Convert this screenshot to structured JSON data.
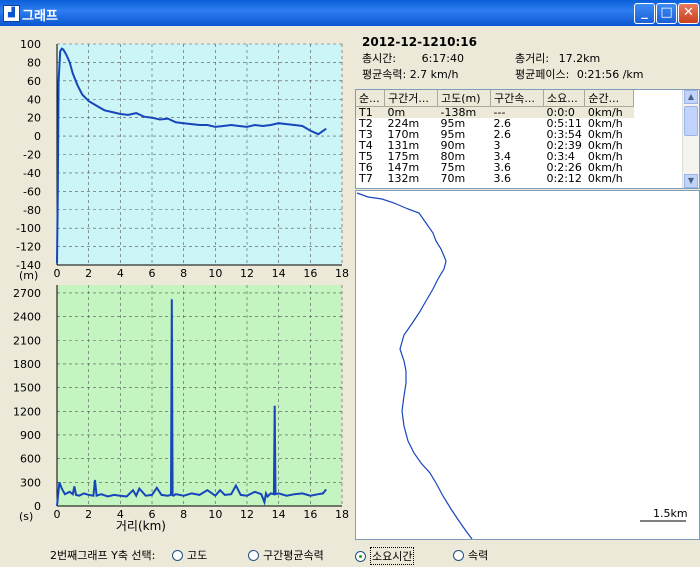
{
  "window": {
    "title": "그래프",
    "app_icon": "chart-icon"
  },
  "info": {
    "date": "2012-12-1210:16",
    "total_time_label": "총시간:",
    "total_time": "6:17:40",
    "total_distance_label": "총거리:",
    "total_distance": "17.2km",
    "avg_speed_label": "평균속력:",
    "avg_speed": "2.7 km/h",
    "avg_pace_label": "평균페이스:",
    "avg_pace": "0:21:56 /km"
  },
  "table": {
    "headers": [
      "순...",
      "구간거...",
      "고도(m)",
      "구간속...",
      "소요...",
      "순간..."
    ],
    "rows": [
      [
        "T1",
        "0m",
        "-138m",
        "---",
        "0:0:0",
        "0km/h"
      ],
      [
        "T2",
        "224m",
        "95m",
        "2.6",
        "0:5:11",
        "0km/h"
      ],
      [
        "T3",
        "170m",
        "95m",
        "2.6",
        "0:3:54",
        "0km/h"
      ],
      [
        "T4",
        "131m",
        "90m",
        "3",
        "0:2:39",
        "0km/h"
      ],
      [
        "T5",
        "175m",
        "80m",
        "3.4",
        "0:3:4",
        "0km/h"
      ],
      [
        "T6",
        "147m",
        "75m",
        "3.6",
        "0:2:26",
        "0km/h"
      ],
      [
        "T7",
        "132m",
        "70m",
        "3.6",
        "0:2:12",
        "0km/h"
      ]
    ]
  },
  "map": {
    "scale_label": "1.5km"
  },
  "radio": {
    "prompt": "2번째그래프 Y축 선택:",
    "options": [
      "고도",
      "구간평균속력",
      "소요시간",
      "속력"
    ],
    "selected_index": 2
  },
  "colors": {
    "top_bg": "#ccf5f8",
    "bottom_bg": "#c4f5c0",
    "line": "#1746ba"
  },
  "chart_data": [
    {
      "type": "line",
      "ylabel": "(m)",
      "xlim": [
        0,
        18
      ],
      "ylim": [
        -140,
        100
      ],
      "xticks": [
        0,
        2,
        4,
        6,
        8,
        10,
        12,
        14,
        16,
        18
      ],
      "yticks": [
        100,
        80,
        60,
        40,
        20,
        0,
        -20,
        -40,
        -60,
        -80,
        -100,
        -120,
        -140
      ],
      "grid": true,
      "series": [
        {
          "x": [
            0,
            0.05,
            0.1,
            0.2,
            0.3,
            0.4,
            0.6,
            0.8,
            1.0,
            1.3,
            1.6,
            2.0,
            2.5,
            3.0,
            3.5,
            4.0,
            4.5,
            5.0,
            5.5,
            6.0,
            6.5,
            7.0,
            7.5,
            8.0,
            8.5,
            9.0,
            9.5,
            10.0,
            10.5,
            11.0,
            11.5,
            12.0,
            12.5,
            13.0,
            13.5,
            14.0,
            14.5,
            15.0,
            15.5,
            16.0,
            16.5,
            17.0
          ],
          "y": [
            -138,
            -60,
            60,
            92,
            95,
            94,
            88,
            80,
            68,
            55,
            45,
            38,
            33,
            28,
            26,
            24,
            23,
            25,
            21,
            20,
            18,
            19,
            15,
            14,
            13,
            12,
            12,
            10,
            11,
            12,
            11,
            10,
            12,
            11,
            12,
            14,
            13,
            12,
            11,
            6,
            2,
            8
          ]
        }
      ]
    },
    {
      "type": "line",
      "ylabel": "(s)",
      "xlabel": "거리(km)",
      "xlim": [
        0,
        18
      ],
      "ylim": [
        0,
        2800
      ],
      "xticks": [
        0,
        2,
        4,
        6,
        8,
        10,
        12,
        14,
        16,
        18
      ],
      "yticks": [
        2700,
        2400,
        2100,
        1800,
        1500,
        1200,
        900,
        600,
        300,
        0
      ],
      "grid": true,
      "series": [
        {
          "x": [
            0,
            0.15,
            0.3,
            0.5,
            0.8,
            1.0,
            1.1,
            1.2,
            1.4,
            1.7,
            2.0,
            2.3,
            2.4,
            2.5,
            2.8,
            3.2,
            3.6,
            4.0,
            4.4,
            4.8,
            5.0,
            5.2,
            5.6,
            6.0,
            6.3,
            6.6,
            7.0,
            7.2,
            7.25,
            7.3,
            7.35,
            7.5,
            8.0,
            8.5,
            9.0,
            9.5,
            10.0,
            10.3,
            10.6,
            11.0,
            11.3,
            11.6,
            12.0,
            12.5,
            12.9,
            13.1,
            13.2,
            13.3,
            13.5,
            13.7,
            13.75,
            13.8,
            14.0,
            14.5,
            15.0,
            15.5,
            16.0,
            16.5,
            16.8,
            17.0
          ],
          "y": [
            0,
            300,
            220,
            150,
            180,
            150,
            250,
            140,
            130,
            160,
            140,
            130,
            330,
            130,
            150,
            120,
            140,
            130,
            120,
            200,
            130,
            220,
            130,
            140,
            230,
            140,
            130,
            140,
            2620,
            140,
            130,
            150,
            130,
            160,
            140,
            200,
            130,
            200,
            140,
            150,
            260,
            140,
            130,
            180,
            150,
            50,
            160,
            120,
            160,
            150,
            1270,
            150,
            160,
            130,
            150,
            160,
            130,
            150,
            160,
            210
          ]
        }
      ]
    }
  ]
}
